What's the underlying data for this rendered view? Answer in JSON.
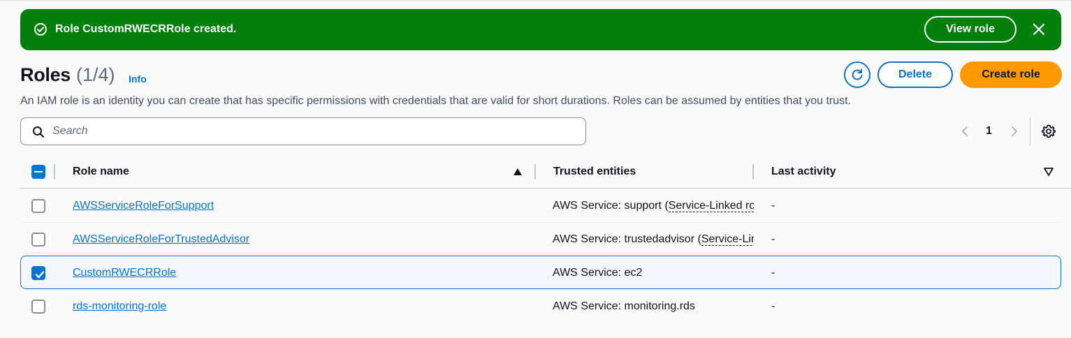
{
  "flash": {
    "message": "Role CustomRWECRRole created.",
    "view_button": "View role",
    "color": "#037f0c"
  },
  "header": {
    "title": "Roles",
    "count": "(1/4)",
    "info": "Info",
    "description": "An IAM role is an identity you can create that has specific permissions with credentials that are valid for short durations. Roles can be assumed by entities that you trust.",
    "delete_label": "Delete",
    "create_label": "Create role",
    "refresh_icon": "refresh-icon"
  },
  "search": {
    "placeholder": "Search",
    "value": ""
  },
  "pagination": {
    "current_page": "1"
  },
  "table": {
    "columns": {
      "role_name": "Role name",
      "trusted_entities": "Trusted entities",
      "last_activity": "Last activity"
    },
    "sort": {
      "column": "Role name",
      "direction": "ascending"
    },
    "rows": [
      {
        "name": "AWSServiceRoleForSupport",
        "trusted_prefix": "AWS Service: support",
        "trusted_link": "Service-Linked role",
        "last_activity": "-",
        "selected": false
      },
      {
        "name": "AWSServiceRoleForTrustedAdvisor",
        "trusted_prefix": "AWS Service: trustedadvisor",
        "trusted_link": "Service-Linked role",
        "last_activity": "-",
        "selected": false
      },
      {
        "name": "CustomRWECRRole",
        "trusted_prefix": "AWS Service: ec2",
        "trusted_link": "",
        "last_activity": "-",
        "selected": true
      },
      {
        "name": "rds-monitoring-role",
        "trusted_prefix": "AWS Service: monitoring.rds",
        "trusted_link": "",
        "last_activity": "-",
        "selected": false
      }
    ]
  },
  "colors": {
    "accent": "#0972d3",
    "primary_button": "#ff9900",
    "success": "#037f0c"
  }
}
